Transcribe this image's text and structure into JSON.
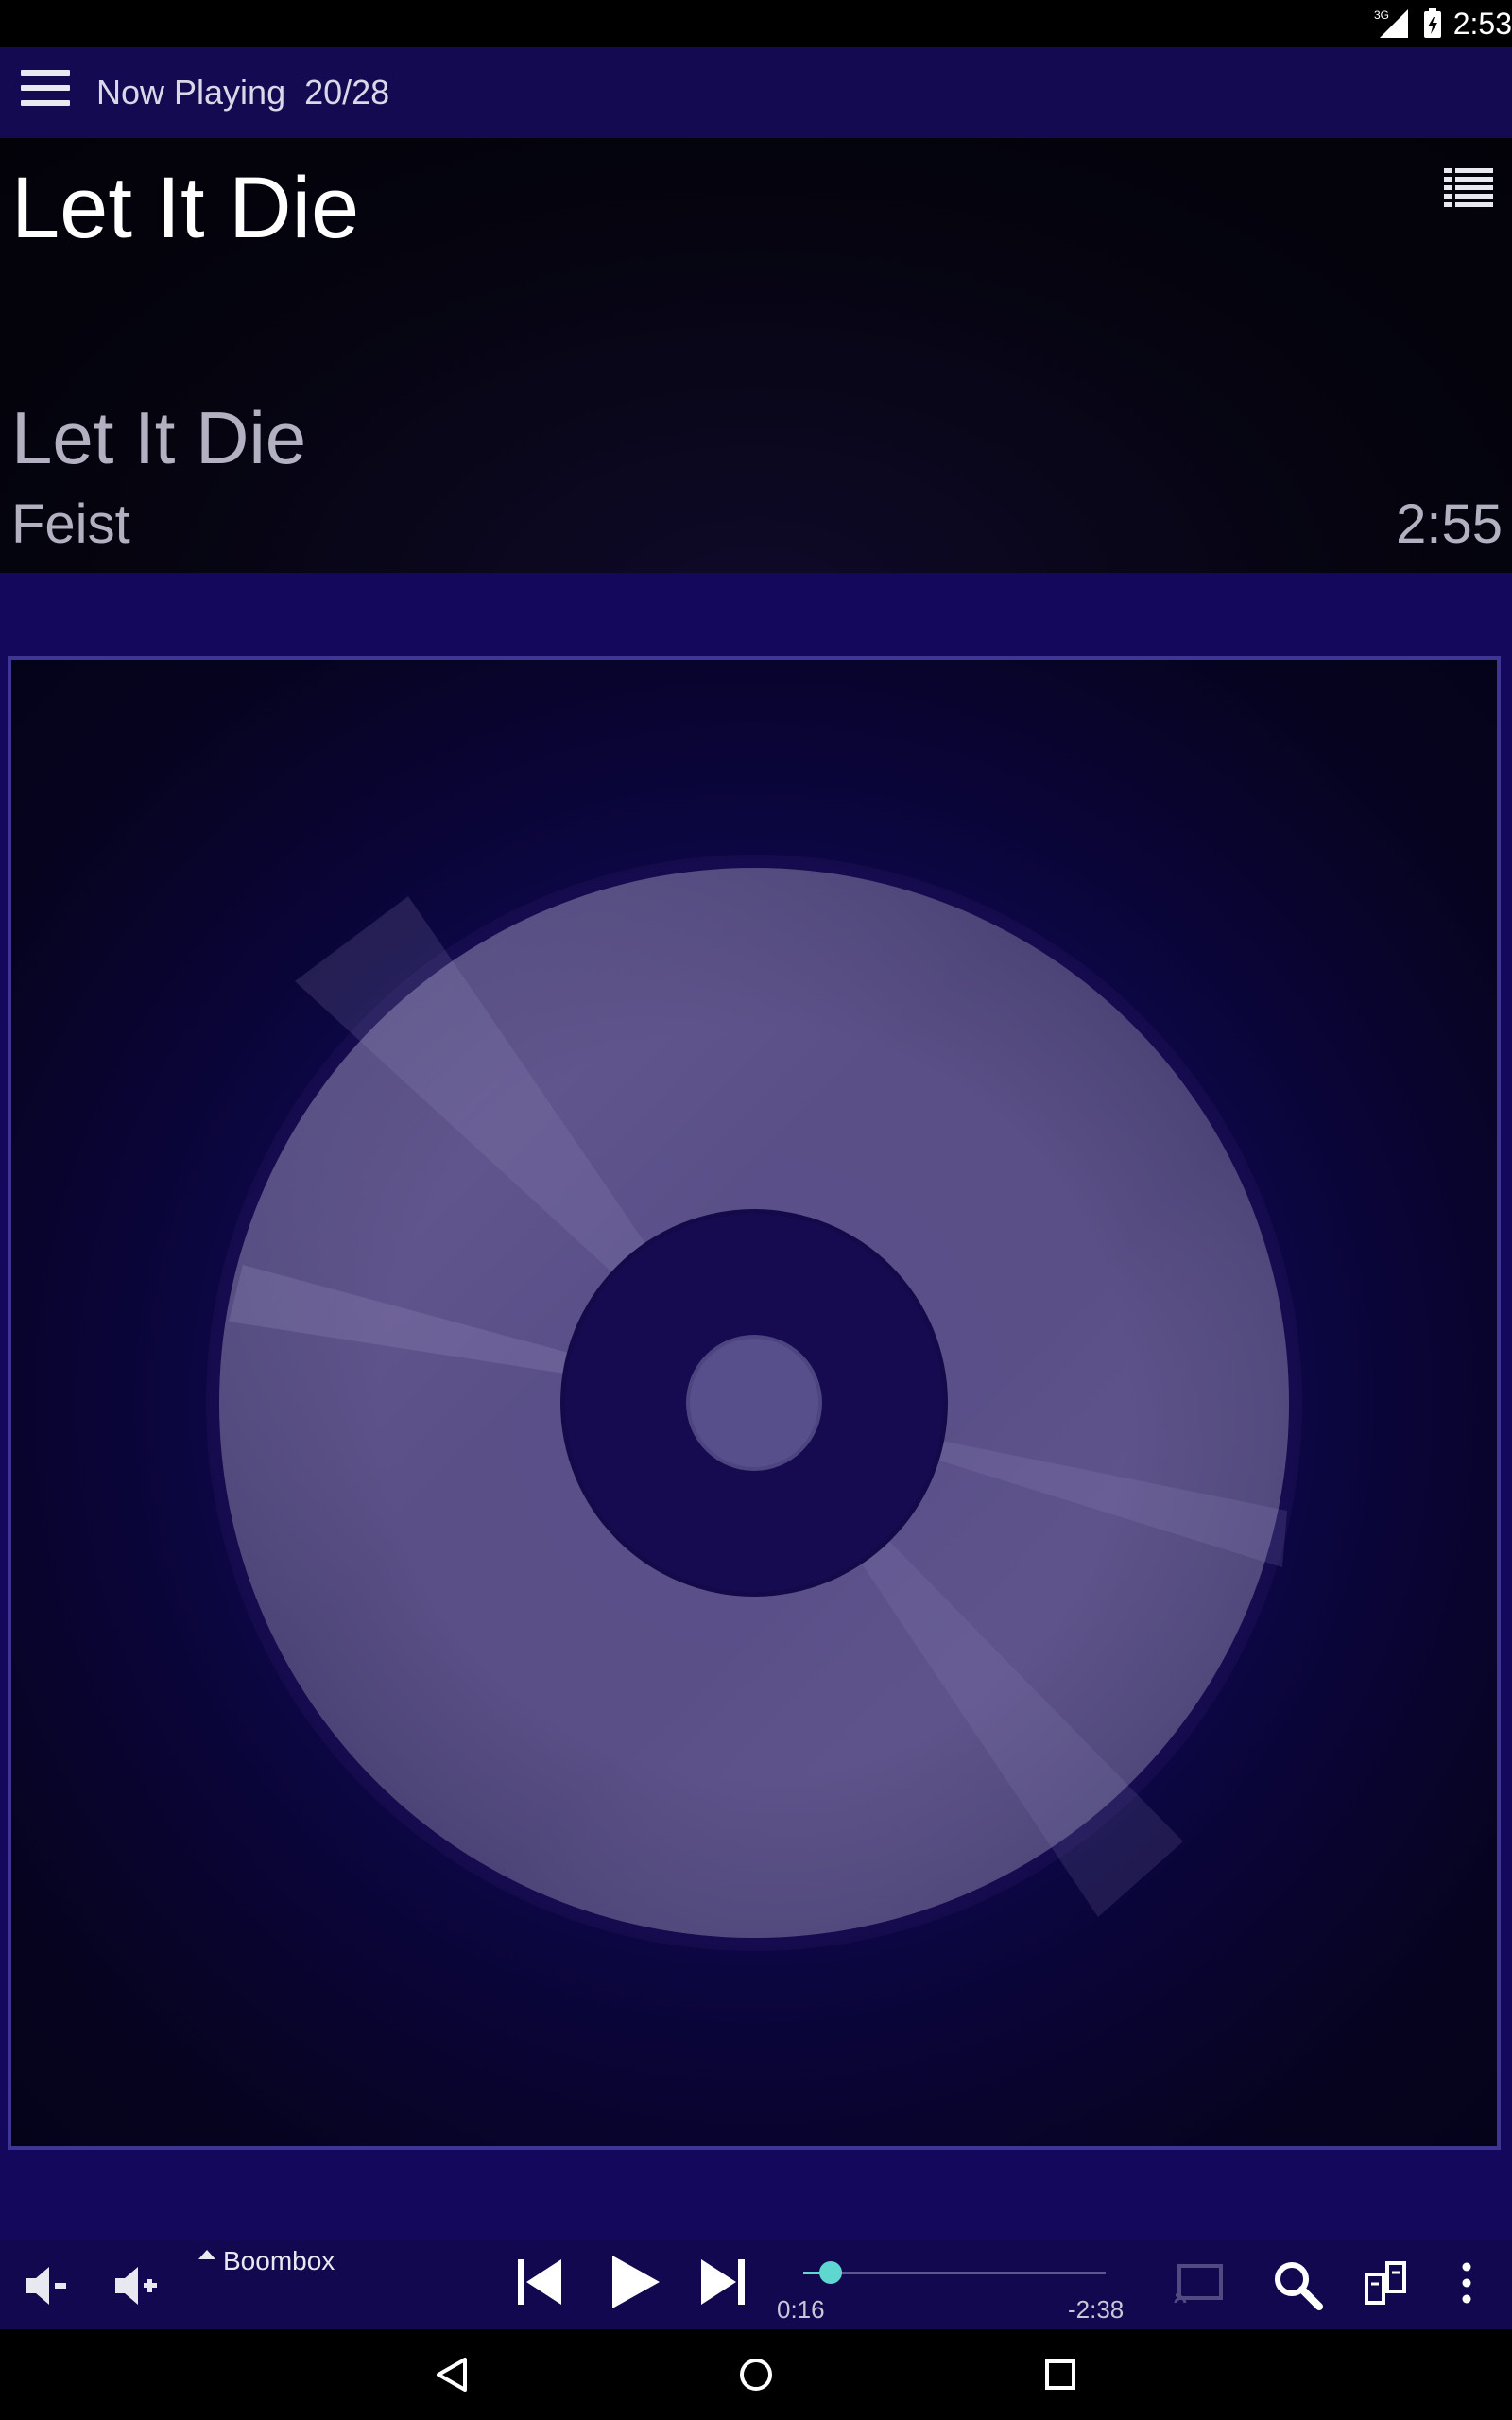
{
  "status_bar": {
    "time": "2:53",
    "network_label": "3G"
  },
  "app_bar": {
    "title": "Now Playing  20/28",
    "menu_icon": "hamburger-menu-icon"
  },
  "header": {
    "playlist_title": "Let It Die",
    "song_title": "Let It Die",
    "artist": "Feist",
    "duration": "2:55",
    "playlist_icon": "list-view-icon"
  },
  "album_art": {
    "image": "cd-disc-placeholder"
  },
  "controls": {
    "output_device": "Boombox",
    "elapsed": "0:16",
    "remaining": "-2:38",
    "progress_fraction": 0.09,
    "accent_color": "#5fd6d0",
    "icons": [
      "volume-down-icon",
      "volume-up-icon",
      "skip-previous-icon",
      "play-icon",
      "skip-next-icon",
      "cast-icon",
      "search-icon",
      "queue-icon",
      "more-vert-icon"
    ]
  },
  "navigation": {
    "icons": [
      "back-icon",
      "home-icon",
      "recents-icon"
    ]
  }
}
